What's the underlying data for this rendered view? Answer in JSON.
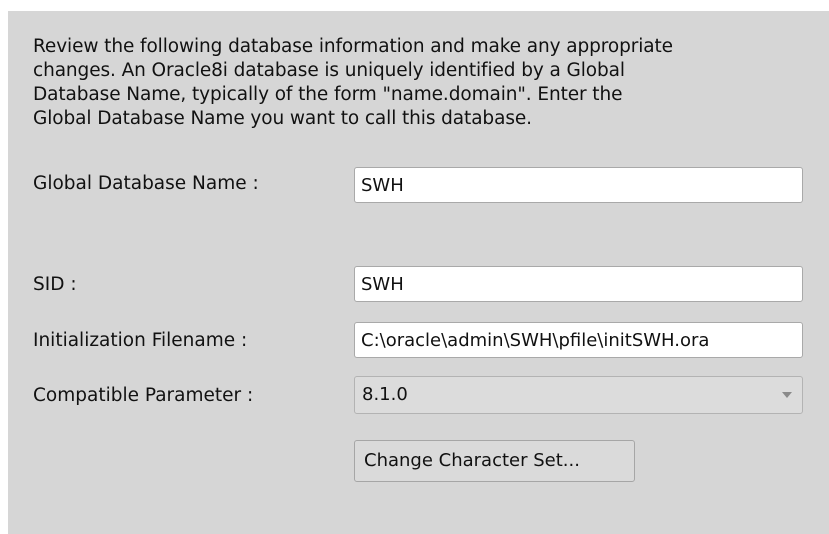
{
  "intro": {
    "text": "Review the following database information and make any appropriate\nchanges.  An Oracle8i database is uniquely identified by a Global\nDatabase Name, typically of the form \"name.domain\".  Enter the\nGlobal Database Name you want to call this database."
  },
  "fields": {
    "global_db_name": {
      "label": "Global Database Name :",
      "value": "SWH"
    },
    "sid": {
      "label": "SID :",
      "value": "SWH"
    },
    "init_filename": {
      "label": "Initialization Filename :",
      "value": "C:\\oracle\\admin\\SWH\\pfile\\initSWH.ora"
    },
    "compatible_param": {
      "label": "Compatible Parameter :",
      "selected": "8.1.0",
      "icon": "chevron-down-icon"
    }
  },
  "buttons": {
    "change_charset": "Change Character Set..."
  },
  "colors": {
    "panel_background": "#d6d6d6",
    "field_background": "#ffffff",
    "combo_background": "#dcdcdc"
  }
}
